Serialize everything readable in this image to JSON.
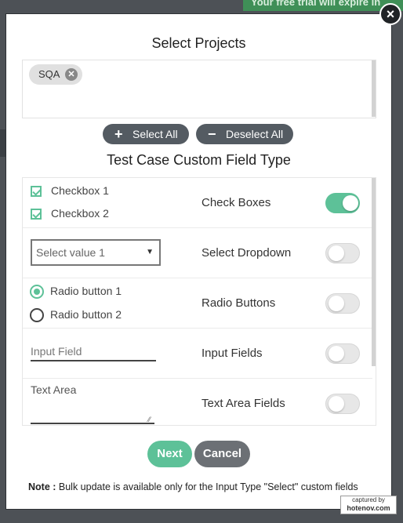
{
  "background": {
    "banner_text": "Your free trial will expire in"
  },
  "modal": {
    "close_symbol": "×",
    "title": "Select Projects",
    "projects": {
      "chips": [
        {
          "label": "SQA",
          "remove_icon": "close-circle-icon"
        }
      ]
    },
    "select_all_label": "Select All",
    "deselect_all_label": "Deselect All",
    "select_all_icon": "+",
    "deselect_all_icon": "−",
    "field_type_title": "Test Case Custom Field Type",
    "field_rows": [
      {
        "type": "Check Boxes",
        "enabled": true,
        "options": [
          "Checkbox 1",
          "Checkbox 2"
        ]
      },
      {
        "type": "Select Dropdown",
        "enabled": false,
        "selected_value": "Select value 1"
      },
      {
        "type": "Radio Buttons",
        "enabled": false,
        "options": [
          "Radio button 1",
          "Radio button 2"
        ],
        "checked_option": "Radio button 1"
      },
      {
        "type": "Input Fields",
        "enabled": false,
        "placeholder": "Input Field"
      },
      {
        "type": "Text Area Fields",
        "enabled": false,
        "placeholder": "Text Area"
      }
    ],
    "next_label": "Next",
    "cancel_label": "Cancel",
    "note_prefix": "Note :",
    "note_text": " Bulk update is available only for the Input Type \"Select\" custom fields"
  },
  "watermark": {
    "line1": "captured by",
    "line2": "hotenov.com"
  },
  "colors": {
    "accent_green": "#5dc198",
    "dark_button": "#545b62",
    "cancel_button": "#6c7075",
    "backdrop": "#4d5156"
  }
}
